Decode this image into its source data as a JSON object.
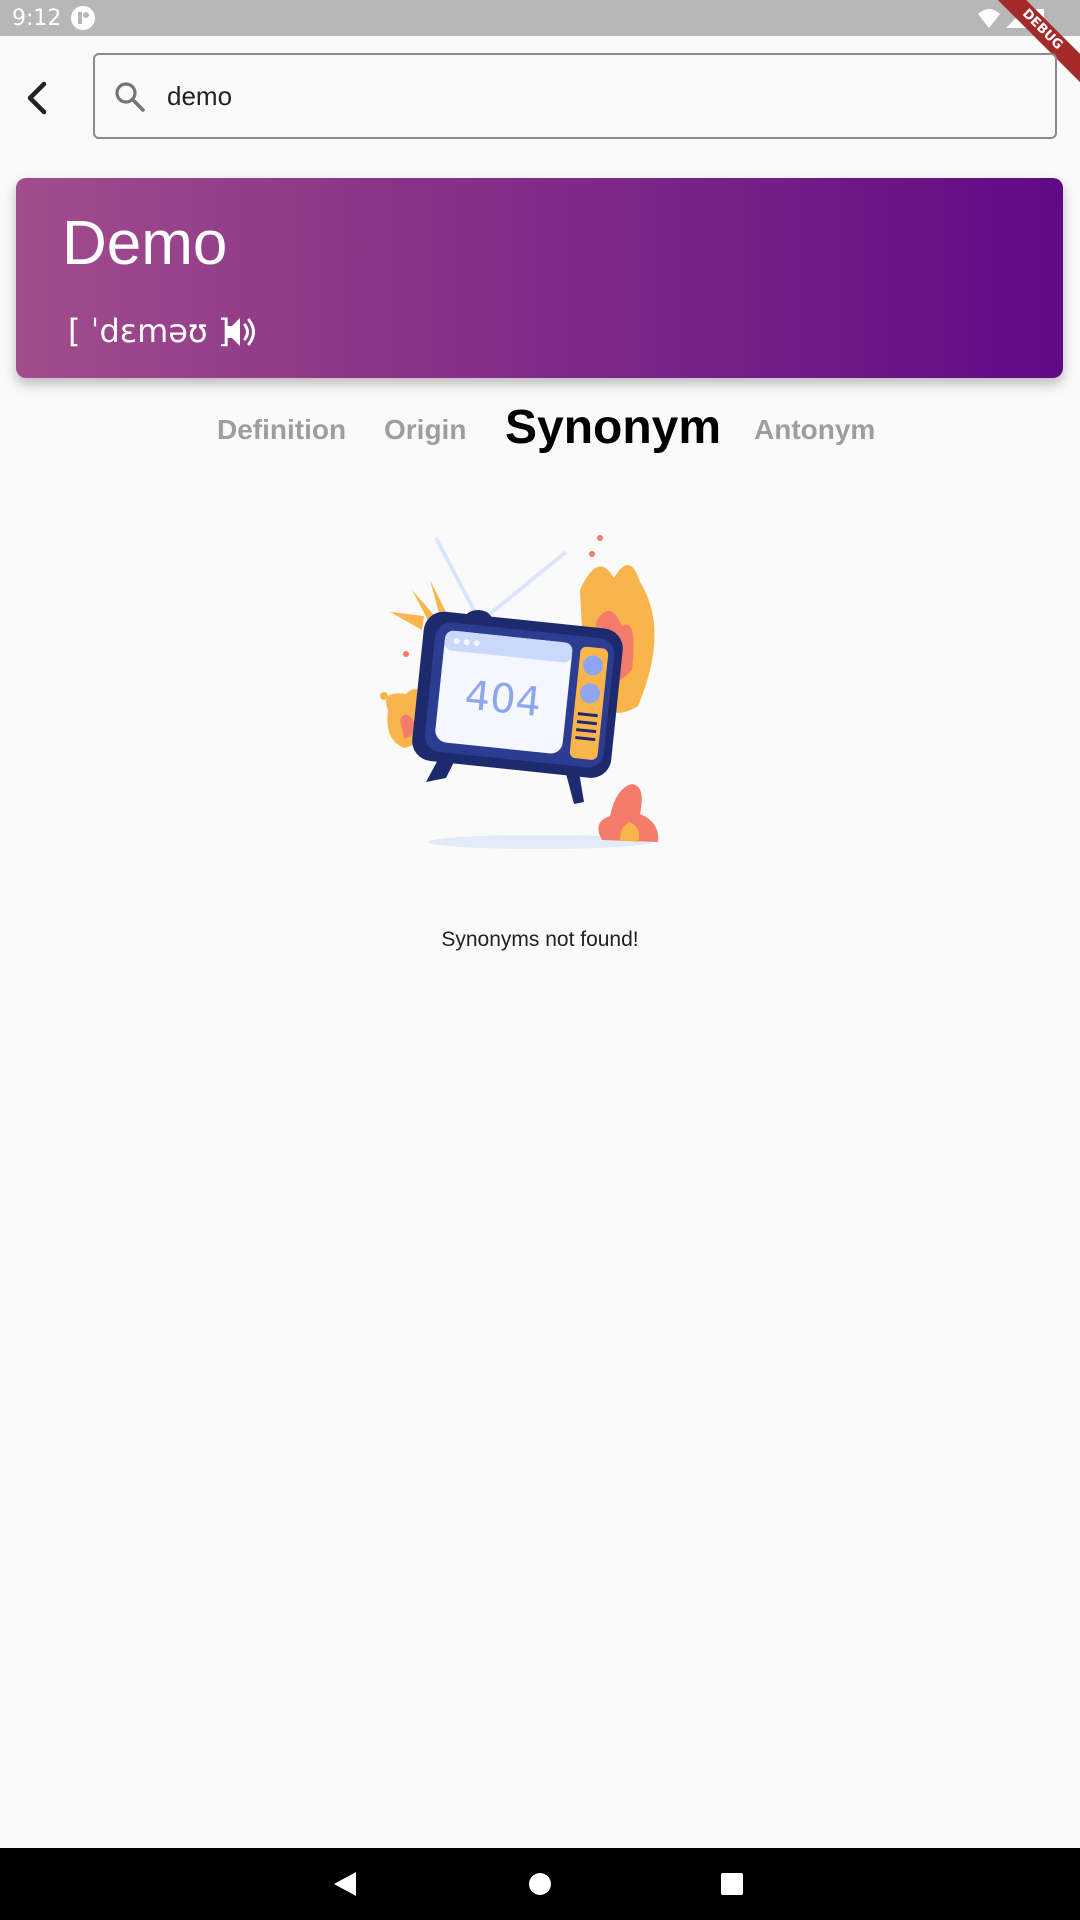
{
  "status_bar": {
    "time": "9:12",
    "debug_label": "DEBUG"
  },
  "search": {
    "value": "demo"
  },
  "word": {
    "title": "Demo",
    "phonetic": "[ ˈdɛməʊ ]"
  },
  "tabs": [
    {
      "label": "Definition",
      "active": false
    },
    {
      "label": "Origin",
      "active": false
    },
    {
      "label": "Synonym",
      "active": true
    },
    {
      "label": "Antonym",
      "active": false
    }
  ],
  "illustration": {
    "screen_text": "404"
  },
  "empty_message": "Synonyms not found!",
  "colors": {
    "header_gradient_start": "#a24d8d",
    "header_gradient_end": "#5f0a85",
    "tab_inactive": "#9e9e9e",
    "tab_active": "#000000"
  },
  "icons": [
    "back-arrow-icon",
    "search-icon",
    "speaker-icon",
    "wifi-icon",
    "signal-icon",
    "battery-icon",
    "nav-back-icon",
    "nav-home-icon",
    "nav-recents-icon"
  ]
}
